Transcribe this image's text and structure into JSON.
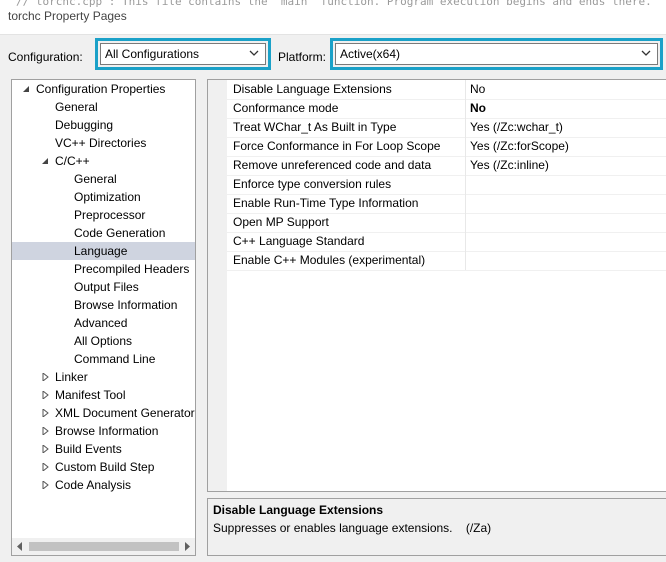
{
  "window": {
    "title": "torchc Property Pages",
    "background_code": "// torchc.cpp : This file contains the 'main' function. Program execution begins and ends there."
  },
  "configuration": {
    "label": "Configuration:",
    "value": "All Configurations"
  },
  "platform": {
    "label": "Platform:",
    "value": "Active(x64)"
  },
  "tree": {
    "items": [
      {
        "label": "Configuration Properties",
        "expander": "expanded"
      },
      {
        "label": "General",
        "expander": "none"
      },
      {
        "label": "Debugging",
        "expander": "none"
      },
      {
        "label": "VC++ Directories",
        "expander": "none"
      },
      {
        "label": "C/C++",
        "expander": "expanded"
      },
      {
        "label": "General",
        "expander": "none"
      },
      {
        "label": "Optimization",
        "expander": "none"
      },
      {
        "label": "Preprocessor",
        "expander": "none"
      },
      {
        "label": "Code Generation",
        "expander": "none"
      },
      {
        "label": "Language",
        "expander": "none",
        "selected": true
      },
      {
        "label": "Precompiled Headers",
        "expander": "none"
      },
      {
        "label": "Output Files",
        "expander": "none"
      },
      {
        "label": "Browse Information",
        "expander": "none"
      },
      {
        "label": "Advanced",
        "expander": "none"
      },
      {
        "label": "All Options",
        "expander": "none"
      },
      {
        "label": "Command Line",
        "expander": "none"
      },
      {
        "label": "Linker",
        "expander": "collapsed"
      },
      {
        "label": "Manifest Tool",
        "expander": "collapsed"
      },
      {
        "label": "XML Document Generator",
        "expander": "collapsed"
      },
      {
        "label": "Browse Information",
        "expander": "collapsed"
      },
      {
        "label": "Build Events",
        "expander": "collapsed"
      },
      {
        "label": "Custom Build Step",
        "expander": "collapsed"
      },
      {
        "label": "Code Analysis",
        "expander": "collapsed"
      }
    ]
  },
  "properties": [
    {
      "name": "Disable Language Extensions",
      "value": "No",
      "bold": false
    },
    {
      "name": "Conformance mode",
      "value": "No",
      "bold": true
    },
    {
      "name": "Treat WChar_t As Built in Type",
      "value": "Yes (/Zc:wchar_t)",
      "bold": false
    },
    {
      "name": "Force Conformance in For Loop Scope",
      "value": "Yes (/Zc:forScope)",
      "bold": false
    },
    {
      "name": "Remove unreferenced code and data",
      "value": "Yes (/Zc:inline)",
      "bold": false
    },
    {
      "name": "Enforce type conversion rules",
      "value": "",
      "bold": false
    },
    {
      "name": "Enable Run-Time Type Information",
      "value": "",
      "bold": false
    },
    {
      "name": "Open MP Support",
      "value": "",
      "bold": false
    },
    {
      "name": "C++ Language Standard",
      "value": "",
      "bold": false
    },
    {
      "name": "Enable C++ Modules (experimental)",
      "value": "",
      "bold": false
    }
  ],
  "description": {
    "title": "Disable Language Extensions",
    "text": "Suppresses or enables language extensions.    (/Za)"
  },
  "colors": {
    "highlight_border": "#1ba1c8",
    "selection": "#cfd4e0"
  }
}
